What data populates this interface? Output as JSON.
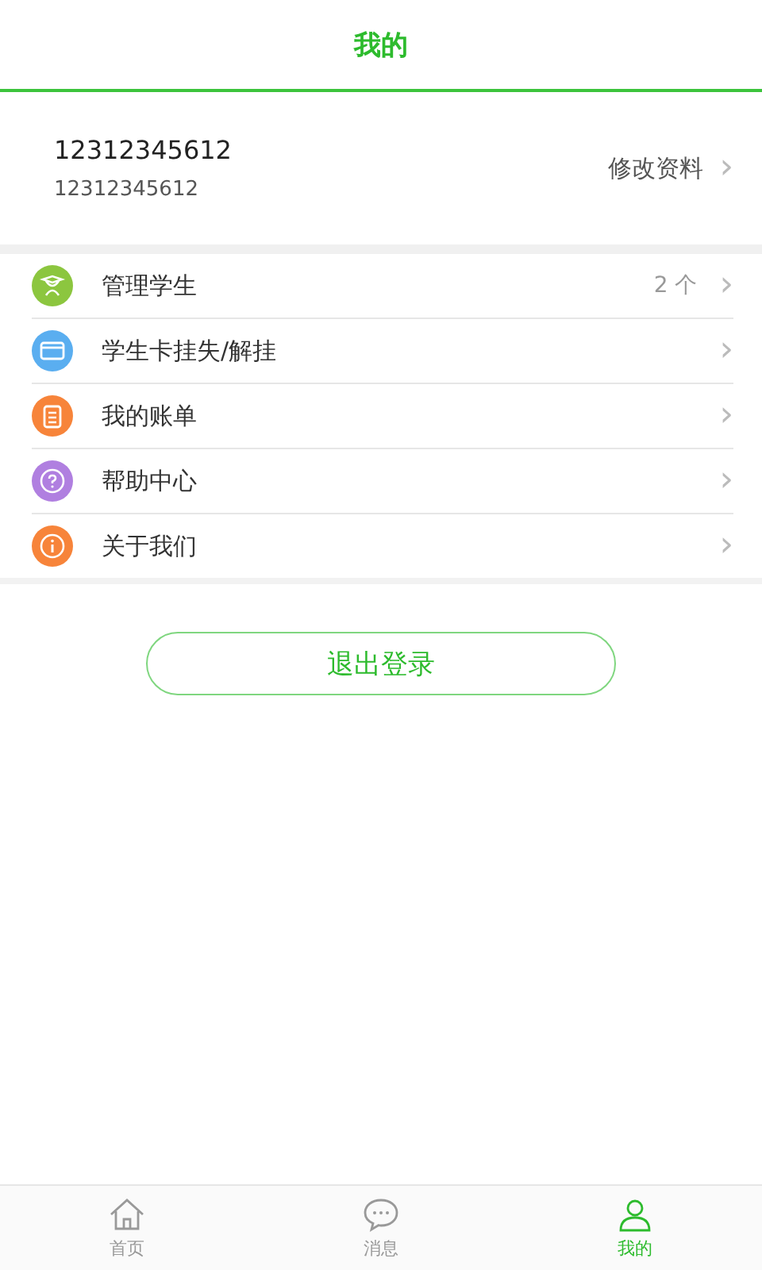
{
  "header": {
    "title": "我的"
  },
  "profile": {
    "name": "12312345612",
    "phone": "12312345612",
    "edit_label": "修改资料",
    "chevron": "›"
  },
  "menu": [
    {
      "kind": "student",
      "color": "#8cc63f",
      "label": "管理学生",
      "count": "2 个",
      "chevron": "›"
    },
    {
      "kind": "card",
      "color": "#5aaef0",
      "label": "学生卡挂失/解挂",
      "chevron": "›"
    },
    {
      "kind": "bill",
      "color": "#f7843a",
      "label": "我的账单",
      "chevron": "›"
    },
    {
      "kind": "help",
      "color": "#b07fe0",
      "label": "帮助中心",
      "chevron": "›"
    },
    {
      "kind": "info",
      "color": "#f7843a",
      "label": "关于我们",
      "chevron": "›"
    }
  ],
  "logout_button": "退出登录",
  "tabs": [
    {
      "kind": "home",
      "label": "首页",
      "selected": false
    },
    {
      "kind": "message",
      "label": "消息",
      "selected": false
    },
    {
      "kind": "me",
      "label": "我的",
      "selected": true
    }
  ]
}
